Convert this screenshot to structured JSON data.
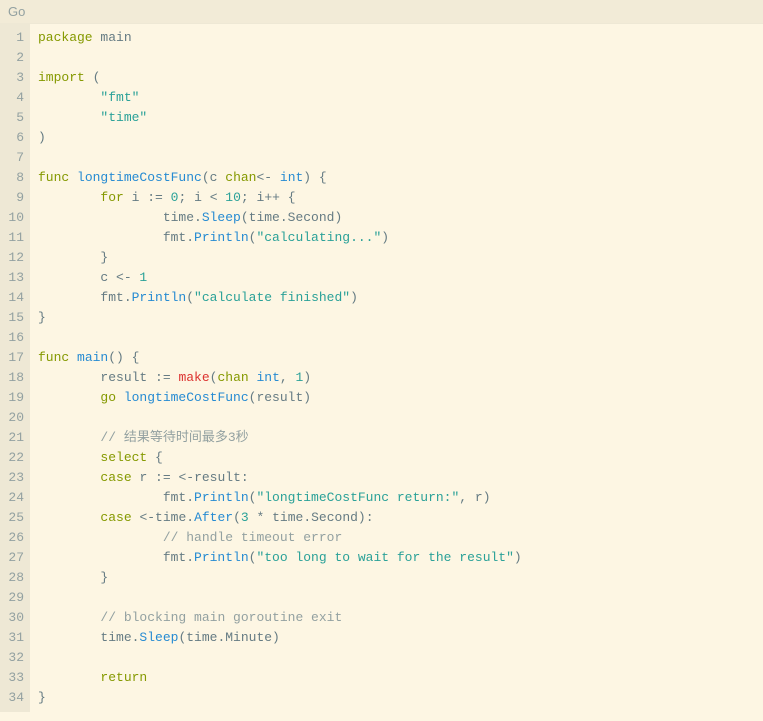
{
  "header": {
    "language": "Go"
  },
  "code": {
    "lines": [
      [
        {
          "t": "package ",
          "c": "keyword"
        },
        {
          "t": "main",
          "c": "ident"
        }
      ],
      [
        {
          "t": "",
          "c": "ident"
        }
      ],
      [
        {
          "t": "import ",
          "c": "keyword"
        },
        {
          "t": "(",
          "c": "punct"
        }
      ],
      [
        {
          "t": "        ",
          "c": "ident"
        },
        {
          "t": "\"fmt\"",
          "c": "string"
        }
      ],
      [
        {
          "t": "        ",
          "c": "ident"
        },
        {
          "t": "\"time\"",
          "c": "string"
        }
      ],
      [
        {
          "t": ")",
          "c": "punct"
        }
      ],
      [
        {
          "t": "",
          "c": "ident"
        }
      ],
      [
        {
          "t": "func ",
          "c": "keyword"
        },
        {
          "t": "longtimeCostFunc",
          "c": "func"
        },
        {
          "t": "(",
          "c": "punct"
        },
        {
          "t": "c ",
          "c": "ident"
        },
        {
          "t": "chan",
          "c": "keyword"
        },
        {
          "t": "<- ",
          "c": "op"
        },
        {
          "t": "int",
          "c": "type"
        },
        {
          "t": ") {",
          "c": "punct"
        }
      ],
      [
        {
          "t": "        ",
          "c": "ident"
        },
        {
          "t": "for ",
          "c": "keyword"
        },
        {
          "t": "i ",
          "c": "ident"
        },
        {
          "t": ":= ",
          "c": "op"
        },
        {
          "t": "0",
          "c": "number"
        },
        {
          "t": "; ",
          "c": "punct"
        },
        {
          "t": "i ",
          "c": "ident"
        },
        {
          "t": "< ",
          "c": "op"
        },
        {
          "t": "10",
          "c": "number"
        },
        {
          "t": "; ",
          "c": "punct"
        },
        {
          "t": "i++ {",
          "c": "ident"
        }
      ],
      [
        {
          "t": "                time.",
          "c": "ident"
        },
        {
          "t": "Sleep",
          "c": "func"
        },
        {
          "t": "(time.Second)",
          "c": "ident"
        }
      ],
      [
        {
          "t": "                fmt.",
          "c": "ident"
        },
        {
          "t": "Println",
          "c": "func"
        },
        {
          "t": "(",
          "c": "punct"
        },
        {
          "t": "\"calculating...\"",
          "c": "string"
        },
        {
          "t": ")",
          "c": "punct"
        }
      ],
      [
        {
          "t": "        }",
          "c": "punct"
        }
      ],
      [
        {
          "t": "        c ",
          "c": "ident"
        },
        {
          "t": "<- ",
          "c": "op"
        },
        {
          "t": "1",
          "c": "number"
        }
      ],
      [
        {
          "t": "        fmt.",
          "c": "ident"
        },
        {
          "t": "Println",
          "c": "func"
        },
        {
          "t": "(",
          "c": "punct"
        },
        {
          "t": "\"calculate finished\"",
          "c": "string"
        },
        {
          "t": ")",
          "c": "punct"
        }
      ],
      [
        {
          "t": "}",
          "c": "punct"
        }
      ],
      [
        {
          "t": "",
          "c": "ident"
        }
      ],
      [
        {
          "t": "func ",
          "c": "keyword"
        },
        {
          "t": "main",
          "c": "func"
        },
        {
          "t": "() {",
          "c": "punct"
        }
      ],
      [
        {
          "t": "        result ",
          "c": "ident"
        },
        {
          "t": ":= ",
          "c": "op"
        },
        {
          "t": "make",
          "c": "builtin"
        },
        {
          "t": "(",
          "c": "punct"
        },
        {
          "t": "chan ",
          "c": "keyword"
        },
        {
          "t": "int",
          "c": "type"
        },
        {
          "t": ", ",
          "c": "punct"
        },
        {
          "t": "1",
          "c": "number"
        },
        {
          "t": ")",
          "c": "punct"
        }
      ],
      [
        {
          "t": "        ",
          "c": "ident"
        },
        {
          "t": "go ",
          "c": "keyword"
        },
        {
          "t": "longtimeCostFunc",
          "c": "func"
        },
        {
          "t": "(result)",
          "c": "ident"
        }
      ],
      [
        {
          "t": "",
          "c": "ident"
        }
      ],
      [
        {
          "t": "        ",
          "c": "ident"
        },
        {
          "t": "// 结果等待时间最多3秒",
          "c": "comment"
        }
      ],
      [
        {
          "t": "        ",
          "c": "ident"
        },
        {
          "t": "select ",
          "c": "keyword"
        },
        {
          "t": "{",
          "c": "punct"
        }
      ],
      [
        {
          "t": "        ",
          "c": "ident"
        },
        {
          "t": "case ",
          "c": "keyword"
        },
        {
          "t": "r ",
          "c": "ident"
        },
        {
          "t": ":= <-",
          "c": "op"
        },
        {
          "t": "result:",
          "c": "ident"
        }
      ],
      [
        {
          "t": "                fmt.",
          "c": "ident"
        },
        {
          "t": "Println",
          "c": "func"
        },
        {
          "t": "(",
          "c": "punct"
        },
        {
          "t": "\"longtimeCostFunc return:\"",
          "c": "string"
        },
        {
          "t": ", r)",
          "c": "ident"
        }
      ],
      [
        {
          "t": "        ",
          "c": "ident"
        },
        {
          "t": "case ",
          "c": "keyword"
        },
        {
          "t": "<-",
          "c": "op"
        },
        {
          "t": "time.",
          "c": "ident"
        },
        {
          "t": "After",
          "c": "func"
        },
        {
          "t": "(",
          "c": "punct"
        },
        {
          "t": "3",
          "c": "number"
        },
        {
          "t": " * ",
          "c": "op"
        },
        {
          "t": "time.Second):",
          "c": "ident"
        }
      ],
      [
        {
          "t": "                ",
          "c": "ident"
        },
        {
          "t": "// handle timeout error",
          "c": "comment"
        }
      ],
      [
        {
          "t": "                fmt.",
          "c": "ident"
        },
        {
          "t": "Println",
          "c": "func"
        },
        {
          "t": "(",
          "c": "punct"
        },
        {
          "t": "\"too long to wait for the result\"",
          "c": "string"
        },
        {
          "t": ")",
          "c": "punct"
        }
      ],
      [
        {
          "t": "        }",
          "c": "punct"
        }
      ],
      [
        {
          "t": "",
          "c": "ident"
        }
      ],
      [
        {
          "t": "        ",
          "c": "ident"
        },
        {
          "t": "// blocking main goroutine exit",
          "c": "comment"
        }
      ],
      [
        {
          "t": "        time.",
          "c": "ident"
        },
        {
          "t": "Sleep",
          "c": "func"
        },
        {
          "t": "(time.Minute)",
          "c": "ident"
        }
      ],
      [
        {
          "t": "",
          "c": "ident"
        }
      ],
      [
        {
          "t": "        ",
          "c": "ident"
        },
        {
          "t": "return",
          "c": "keyword"
        }
      ],
      [
        {
          "t": "}",
          "c": "punct"
        }
      ]
    ]
  }
}
